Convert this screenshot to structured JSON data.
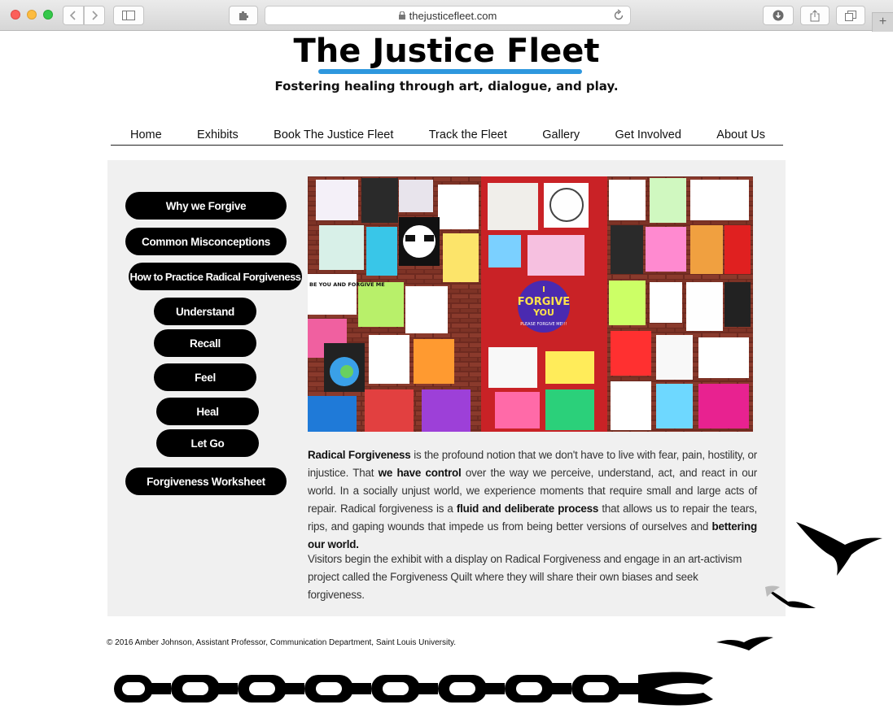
{
  "browser": {
    "url": "thejusticefleet.com"
  },
  "header": {
    "title": "The Justice Fleet",
    "tagline": "Fostering healing through art, dialogue, and play."
  },
  "nav": {
    "items": [
      "Home",
      "Exhibits",
      "Book The Justice Fleet",
      "Track the Fleet",
      "Gallery",
      "Get Involved",
      "About Us"
    ]
  },
  "sidebar": {
    "why": "Why we Forgive",
    "misconceptions": "Common Misconceptions",
    "how": "How to Practice Radical Forgiveness",
    "understand": "Understand",
    "recall": "Recall",
    "feel": "Feel",
    "heal": "Heal",
    "let_go": "Let Go",
    "worksheet": "Forgiveness Worksheet"
  },
  "main": {
    "p1": {
      "t1": "Radical Forgiveness",
      "t2": " is the profound notion that we don't have to live with fear, pain, hostility, or injustice. That ",
      "t3": "we have control",
      "t4": " over the way we perceive, understand, act, and react in our world. In a socially unjust world, we experience moments that require small and large acts of repair. Radical forgiveness is a ",
      "t5": "fluid and deliberate process",
      "t6": " that allows us to repair the tears, rips, and gaping wounds that impede us from being better versions of ourselves and ",
      "t7": "bettering our world."
    },
    "p2": "Visitors begin the exhibit with a display on Radical Forgiveness and engage in an art-activism project called the Forgiveness Quilt where they will share their own biases and seek forgiveness.",
    "image": {
      "center_text_1": "I",
      "center_text_2": "FORGIVE",
      "center_text_3": "YOU",
      "center_text_4": "PLEASE FORGIVE ME!!!",
      "left_text": "BE YOU AND FORGIVE ME"
    }
  },
  "footer": {
    "copyright": "© 2016 Amber Johnson, Assistant Professor, Communication Department, Saint Louis University."
  }
}
